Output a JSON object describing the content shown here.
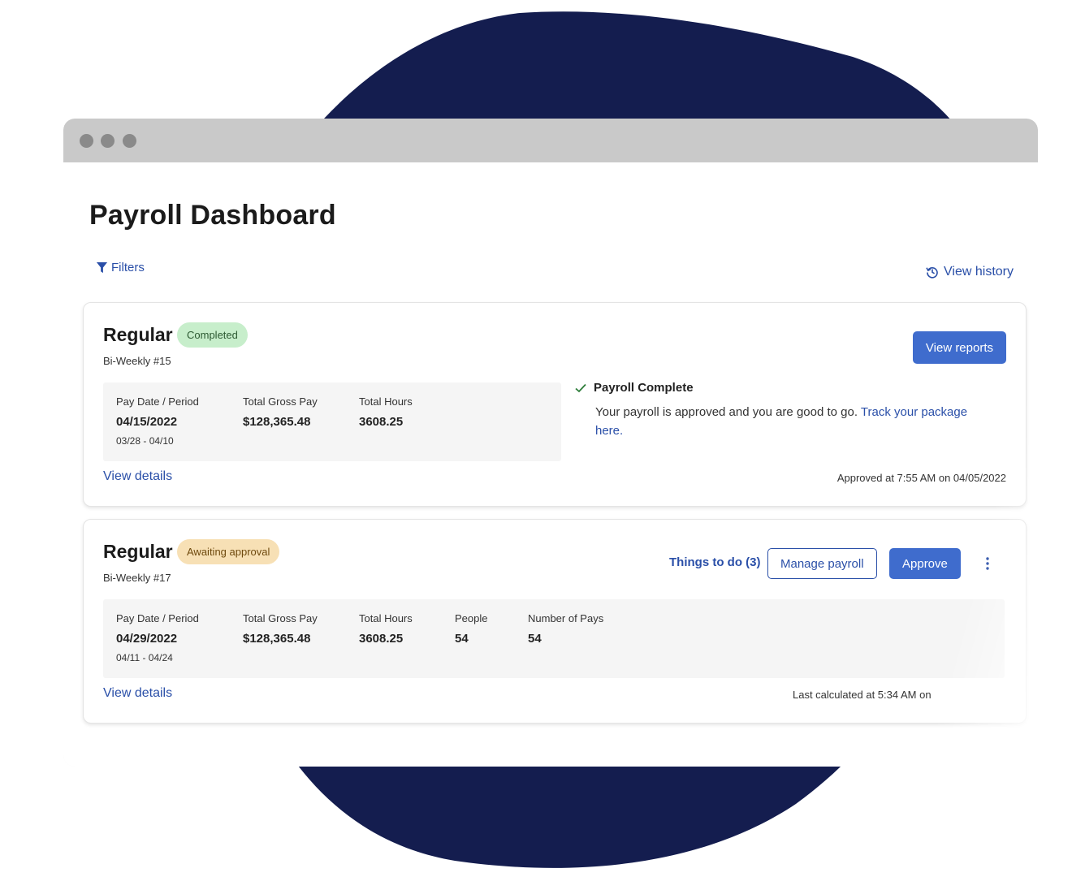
{
  "page": {
    "title": "Payroll Dashboard",
    "filters_label": "Filters",
    "view_history_label": "View history"
  },
  "colors": {
    "accent": "#3f6ccd",
    "link": "#2a4fa8",
    "backdrop": "#141d4f",
    "completed_badge": "#c7eecb",
    "awaiting_badge": "#f7e0b5"
  },
  "cards": [
    {
      "title": "Regular",
      "status": "Completed",
      "subtitle": "Bi-Weekly #15",
      "stats": {
        "pay_date_label": "Pay Date / Period",
        "pay_date": "04/15/2022",
        "period": "03/28 - 04/10",
        "gross_label": "Total Gross Pay",
        "gross": "$128,365.48",
        "hours_label": "Total Hours",
        "hours": "3608.25"
      },
      "view_details": "View details",
      "primary_button": "View reports",
      "message": {
        "heading": "Payroll Complete",
        "body": "Your payroll is approved and you are good to go. ",
        "link": "Track your package here."
      },
      "footer_note": "Approved at 7:55 AM on 04/05/2022"
    },
    {
      "title": "Regular",
      "status": "Awaiting approval",
      "subtitle": "Bi-Weekly #17",
      "stats": {
        "pay_date_label": "Pay Date / Period",
        "pay_date": "04/29/2022",
        "period": "04/11 - 04/24",
        "gross_label": "Total Gross Pay",
        "gross": "$128,365.48",
        "hours_label": "Total Hours",
        "hours": "3608.25",
        "people_label": "People",
        "people": "54",
        "pays_label": "Number of Pays",
        "pays": "54"
      },
      "view_details": "View details",
      "todo_label": "Things to do (3)",
      "secondary_button": "Manage payroll",
      "primary_button": "Approve",
      "footer_note": "Last calculated at 5:34 AM on"
    }
  ]
}
